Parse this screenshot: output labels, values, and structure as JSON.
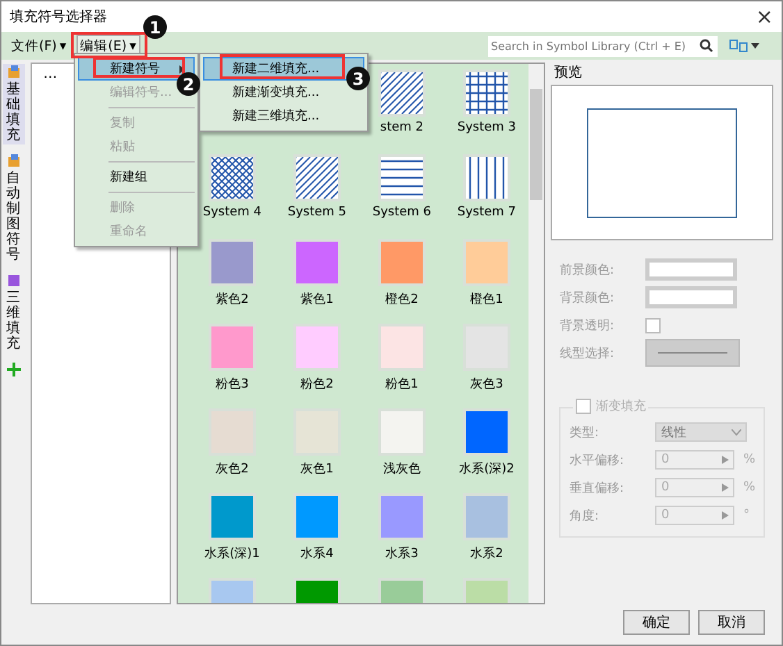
{
  "window": {
    "title": "填充符号选择器",
    "close": "×"
  },
  "menubar": [
    {
      "label": "文件(F)",
      "caret": "▾",
      "selected": false
    },
    {
      "label": "编辑(E)",
      "caret": "▾",
      "selected": true
    }
  ],
  "search": {
    "placeholder": "Search in Symbol Library (Ctrl + E)"
  },
  "side_tabs": [
    {
      "label": "基础填充",
      "selected": true,
      "kind": "folder"
    },
    {
      "label": "自动制图符号",
      "selected": false,
      "kind": "folder"
    },
    {
      "label": "三维填充",
      "selected": false,
      "kind": "cube"
    },
    {
      "selected": false,
      "kind": "add"
    }
  ],
  "tree": {
    "root": "…"
  },
  "edit_menu": [
    {
      "label": "新建符号",
      "disabled": false,
      "selected": true,
      "submenu": true
    },
    {
      "label": "编辑符号...",
      "disabled": true,
      "selected": false,
      "submenu": false
    },
    {
      "kind": "separator"
    },
    {
      "label": "复制",
      "disabled": true,
      "selected": false,
      "submenu": false
    },
    {
      "label": "粘贴",
      "disabled": true,
      "selected": false,
      "submenu": false
    },
    {
      "kind": "separator"
    },
    {
      "label": "新建组",
      "disabled": false,
      "selected": false,
      "submenu": false
    },
    {
      "kind": "separator"
    },
    {
      "label": "删除",
      "disabled": true,
      "selected": false,
      "submenu": false
    },
    {
      "label": "重命名",
      "disabled": true,
      "selected": false,
      "submenu": false
    }
  ],
  "submenu": [
    {
      "label": "新建二维填充...",
      "selected": true
    },
    {
      "label": "新建渐变填充...",
      "selected": false
    },
    {
      "label": "新建三维填充...",
      "selected": false
    }
  ],
  "symbols": [
    {
      "kind": "covered"
    },
    {
      "kind": "covered"
    },
    {
      "kind": "diagonal",
      "label": "stem 2"
    },
    {
      "kind": "grid",
      "label": "System 3"
    },
    {
      "kind": "crosshatch",
      "label": "System 4"
    },
    {
      "kind": "diagonal",
      "label": "System 5"
    },
    {
      "kind": "horizontal",
      "label": "System 6"
    },
    {
      "kind": "vertical",
      "label": "System 7"
    },
    {
      "kind": "color",
      "label": "紫色2",
      "color": "#9999cc"
    },
    {
      "kind": "color",
      "label": "紫色1",
      "color": "#cc66ff"
    },
    {
      "kind": "color",
      "label": "橙色2",
      "color": "#ff9966"
    },
    {
      "kind": "color",
      "label": "橙色1",
      "color": "#ffcc99"
    },
    {
      "kind": "color",
      "label": "粉色3",
      "color": "#ff99cc"
    },
    {
      "kind": "color",
      "label": "粉色2",
      "color": "#ffccff"
    },
    {
      "kind": "color",
      "label": "粉色1",
      "color": "#fce4e4"
    },
    {
      "kind": "color",
      "label": "灰色3",
      "color": "#e4e4e4"
    },
    {
      "kind": "color",
      "label": "灰色2",
      "color": "#e6dcd2"
    },
    {
      "kind": "color",
      "label": "灰色1",
      "color": "#e6e4d6"
    },
    {
      "kind": "color",
      "label": "浅灰色",
      "color": "#f4f4f0"
    },
    {
      "kind": "color",
      "label": "水系(深)2",
      "color": "#0066ff"
    },
    {
      "kind": "color",
      "label": "水系(深)1",
      "color": "#0099cc"
    },
    {
      "kind": "color",
      "label": "水系4",
      "color": "#0099ff"
    },
    {
      "kind": "color",
      "label": "水系3",
      "color": "#9999ff"
    },
    {
      "kind": "color",
      "label": "水系2",
      "color": "#a8c0e0"
    },
    {
      "kind": "color",
      "color": "#a8c8f0"
    },
    {
      "kind": "color",
      "color": "#009900"
    },
    {
      "kind": "color",
      "color": "#99cc99"
    },
    {
      "kind": "color",
      "color": "#bbdda6"
    }
  ],
  "preview": {
    "title": "预览"
  },
  "properties": [
    {
      "label": "前景颜色:",
      "kind": "color"
    },
    {
      "label": "背景颜色:",
      "kind": "color"
    },
    {
      "label": "背景透明:",
      "kind": "checkbox",
      "checked": false
    },
    {
      "label": "线型选择:",
      "kind": "line"
    }
  ],
  "gradient": {
    "label": "渐变填充",
    "checked": false,
    "type_label": "类型:",
    "type_value": "线性",
    "fields": [
      {
        "label": "水平偏移:",
        "value": "0",
        "unit": "%"
      },
      {
        "label": "垂直偏移:",
        "value": "0",
        "unit": "%"
      },
      {
        "label": "角度:",
        "value": "0",
        "unit": "°"
      }
    ]
  },
  "buttons": [
    {
      "label": "确定"
    },
    {
      "label": "取消"
    }
  ],
  "annotations": [
    "1",
    "2",
    "3"
  ]
}
